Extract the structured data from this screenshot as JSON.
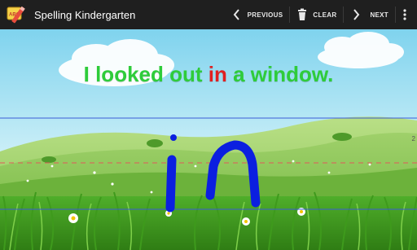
{
  "app": {
    "title": "Spelling Kindergarten",
    "icon_badge": "ABC"
  },
  "toolbar": {
    "previous_label": "PREVIOUS",
    "clear_label": "CLEAR",
    "next_label": "NEXT",
    "icons": {
      "previous": "chevron-left-icon",
      "clear": "trash-icon",
      "next": "chevron-right-icon",
      "overflow": "overflow-menu-icon"
    }
  },
  "sentence": {
    "before": "I looked out ",
    "target_word": "in",
    "after": " a window."
  },
  "canvas": {
    "ruler_label": "2",
    "handwritten_word": "in",
    "stroke_color": "#0b1fe0",
    "sentence_color": "#2ecc3a",
    "highlight_color": "#e02020"
  }
}
